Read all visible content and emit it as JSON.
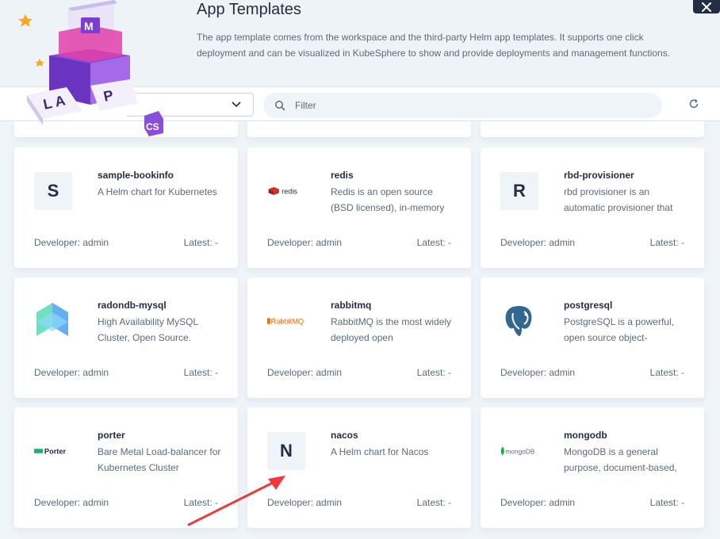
{
  "banner": {
    "title": "App Templates",
    "description": "The app template comes from the workspace and the third-party Helm app templates. It supports one click deployment and can be visualized in KubeSphere to show and provide deployments and management functions."
  },
  "toolbar": {
    "search_placeholder": "Filter"
  },
  "icons": {
    "close": "close-icon",
    "search": "search-icon",
    "refresh": "refresh-icon",
    "chevron": "chevron-down-icon"
  },
  "labels": {
    "developer_prefix": "Developer: ",
    "latest_prefix": "Latest: "
  },
  "apps": [
    {
      "name": "sample-bookinfo",
      "desc": "A Helm chart for Kubernetes",
      "developer": "Developer: admin",
      "latest": "Latest: -",
      "logo": "S",
      "logo_type": "letter"
    },
    {
      "name": "redis",
      "desc": "Redis is an open source (BSD licensed), in-memory",
      "developer": "Developer: admin",
      "latest": "Latest: -",
      "logo": "redis",
      "logo_type": "redis"
    },
    {
      "name": "rbd-provisioner",
      "desc": "rbd provisioner is an automatic provisioner that",
      "developer": "Developer: admin",
      "latest": "Latest: -",
      "logo": "R",
      "logo_type": "letter"
    },
    {
      "name": "radondb-mysql",
      "desc": "High Availability MySQL Cluster, Open Source.",
      "developer": "Developer: admin",
      "latest": "Latest: -",
      "logo": "",
      "logo_type": "radondb"
    },
    {
      "name": "rabbitmq",
      "desc": "RabbitMQ is the most widely deployed open",
      "developer": "Developer: admin",
      "latest": "Latest: -",
      "logo": "RabbitMQ",
      "logo_type": "rabbitmq"
    },
    {
      "name": "postgresql",
      "desc": "PostgreSQL is a powerful, open source object-",
      "developer": "Developer: admin",
      "latest": "Latest: -",
      "logo": "",
      "logo_type": "postgres"
    },
    {
      "name": "porter",
      "desc": "Bare Metal Load-balancer for Kubernetes Cluster",
      "developer": "Developer: admin",
      "latest": "Latest: -",
      "logo": "Porter",
      "logo_type": "porter"
    },
    {
      "name": "nacos",
      "desc": "A Helm chart for Nacos",
      "developer": "Developer: admin",
      "latest": "Latest: -",
      "logo": "N",
      "logo_type": "letter"
    },
    {
      "name": "mongodb",
      "desc": "MongoDB is a general purpose, document-based,",
      "developer": "Developer: admin",
      "latest": "Latest: -",
      "logo": "mongoDB",
      "logo_type": "mongodb"
    }
  ]
}
